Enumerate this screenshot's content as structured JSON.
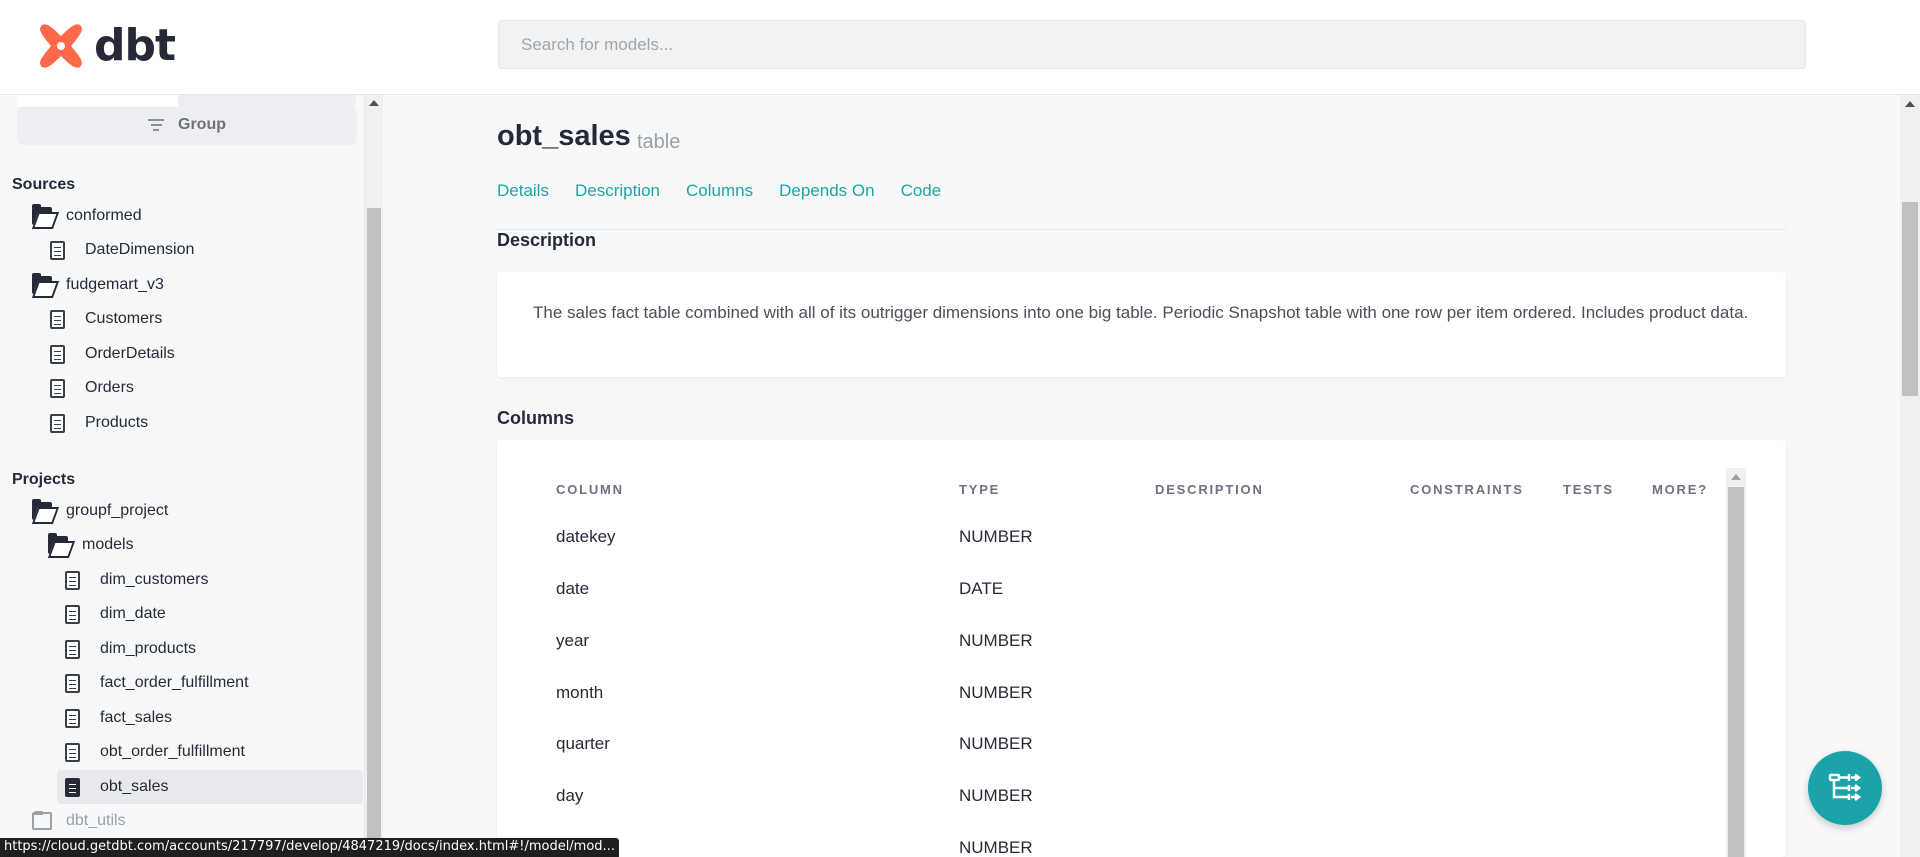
{
  "header": {
    "logo_text": "dbt",
    "search_placeholder": "Search for models..."
  },
  "sidebar": {
    "group_label": "Group",
    "sources_title": "Sources",
    "sources": [
      {
        "label": "conformed",
        "type": "folder"
      },
      {
        "label": "DateDimension",
        "type": "file"
      },
      {
        "label": "fudgemart_v3",
        "type": "folder"
      },
      {
        "label": "Customers",
        "type": "file"
      },
      {
        "label": "OrderDetails",
        "type": "file"
      },
      {
        "label": "Orders",
        "type": "file"
      },
      {
        "label": "Products",
        "type": "file"
      }
    ],
    "projects_title": "Projects",
    "projects": [
      {
        "label": "groupf_project",
        "type": "folder"
      },
      {
        "label": "models",
        "type": "folder"
      },
      {
        "label": "dim_customers",
        "type": "file"
      },
      {
        "label": "dim_date",
        "type": "file"
      },
      {
        "label": "dim_products",
        "type": "file"
      },
      {
        "label": "fact_order_fulfillment",
        "type": "file"
      },
      {
        "label": "fact_sales",
        "type": "file"
      },
      {
        "label": "obt_order_fulfillment",
        "type": "file"
      },
      {
        "label": "obt_sales",
        "type": "file",
        "active": true
      },
      {
        "label": "dbt_utils",
        "type": "folder"
      }
    ]
  },
  "model": {
    "name": "obt_sales",
    "materialization": "table",
    "nav": [
      "Details",
      "Description",
      "Columns",
      "Depends On",
      "Code"
    ],
    "description_title": "Description",
    "description": "The sales fact table combined with all of its outrigger dimensions into one big table. Periodic Snapshot table with one row per item ordered. Includes product data.",
    "columns_title": "Columns",
    "columns_headers": [
      "COLUMN",
      "TYPE",
      "DESCRIPTION",
      "CONSTRAINTS",
      "TESTS",
      "MORE?"
    ],
    "columns": [
      {
        "name": "datekey",
        "type": "NUMBER"
      },
      {
        "name": "date",
        "type": "DATE"
      },
      {
        "name": "year",
        "type": "NUMBER"
      },
      {
        "name": "month",
        "type": "NUMBER"
      },
      {
        "name": "quarter",
        "type": "NUMBER"
      },
      {
        "name": "day",
        "type": "NUMBER"
      },
      {
        "name": "",
        "type": "NUMBER"
      }
    ]
  },
  "status_url": "https://cloud.getdbt.com/accounts/217797/develop/4847219/docs/index.html#!/model/mod...",
  "colors": {
    "accent": "#1ba6a6",
    "brand": "#ff694b",
    "fab": "#1aa3a8"
  }
}
